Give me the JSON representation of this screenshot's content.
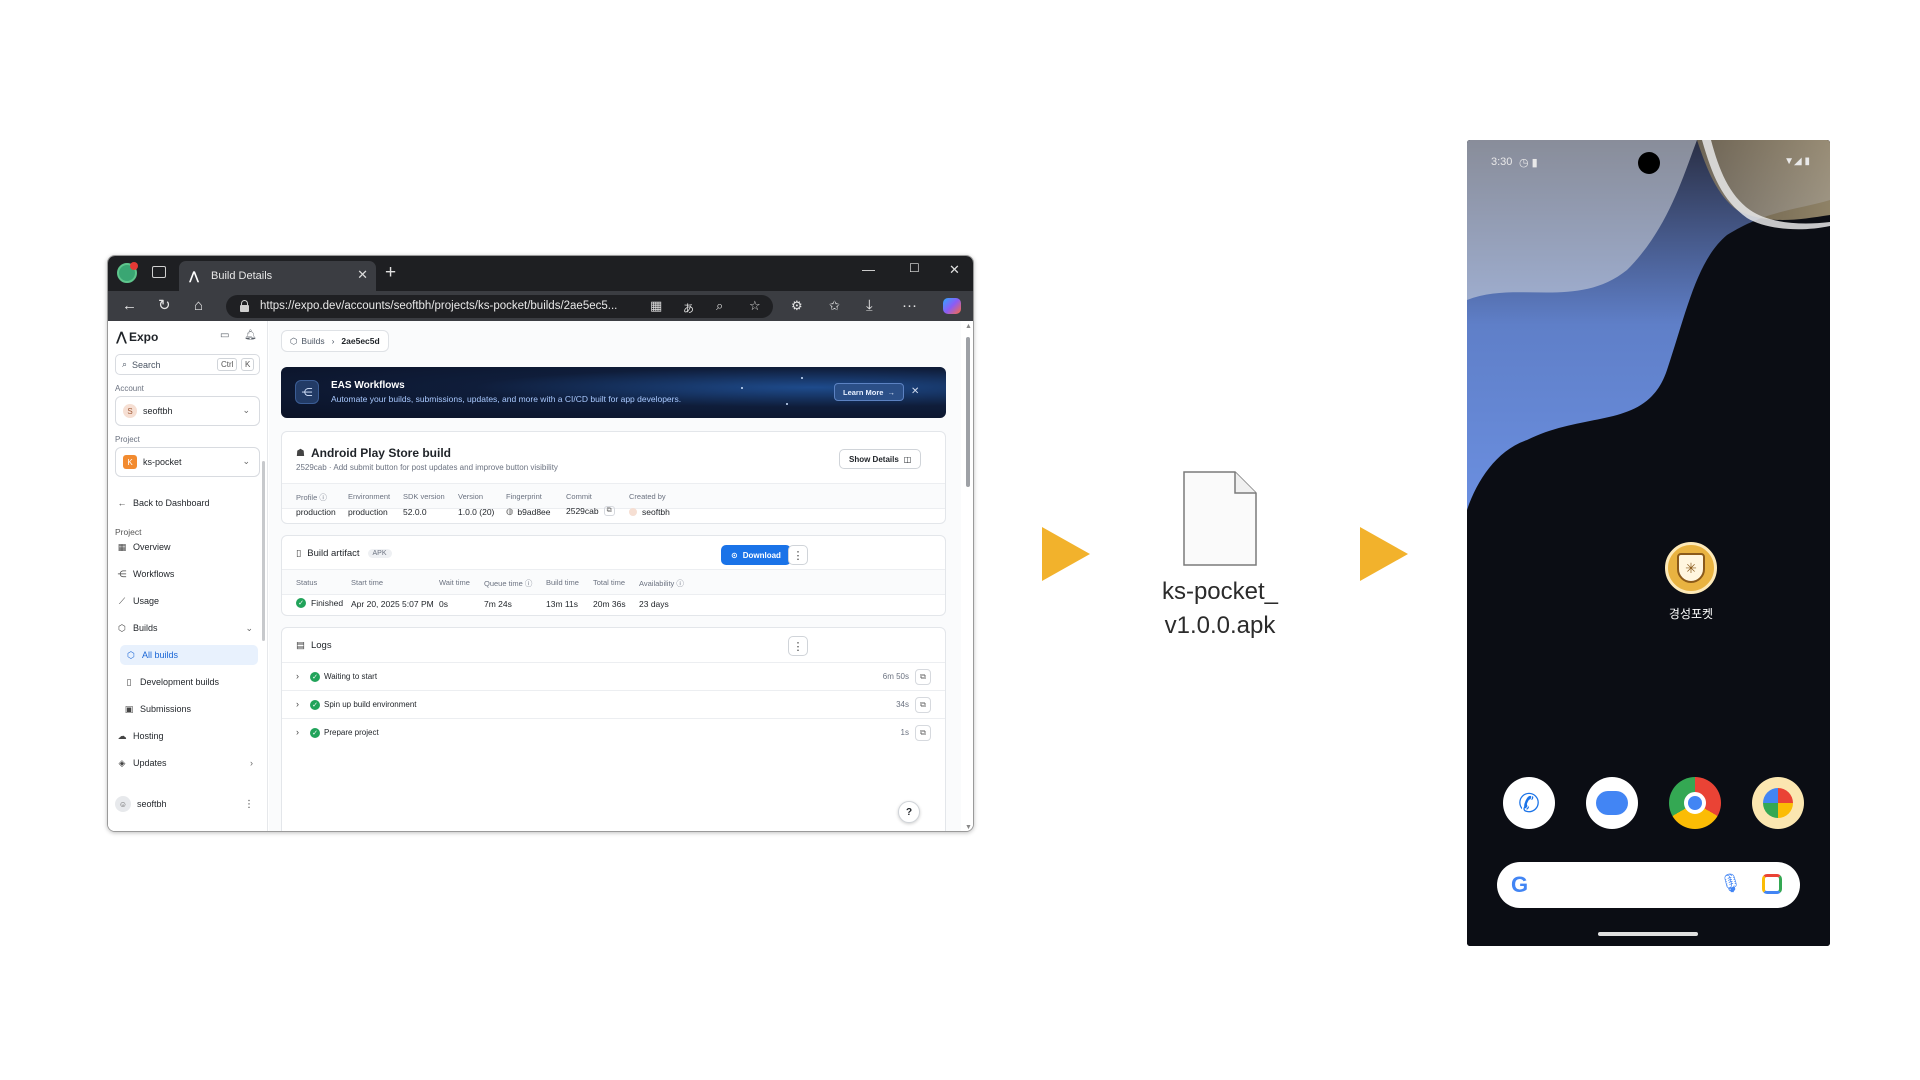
{
  "browser": {
    "tab_title": "Build Details",
    "url": "https://expo.dev/accounts/seoftbh/projects/ks-pocket/builds/2ae5ec5...",
    "icons": [
      "back-arrow-icon",
      "refresh-icon",
      "home-icon",
      "lock-icon",
      "reader-icon",
      "translate-icon",
      "zoom-icon",
      "star-icon",
      "extensions-icon",
      "favorites-icon",
      "download-icon",
      "more-icon",
      "copilot-icon"
    ]
  },
  "sidebar": {
    "brand": "Expo",
    "search_placeholder": "Search",
    "shortcut_ctrl": "Ctrl",
    "shortcut_k": "K",
    "account_label": "Account",
    "account_name": "seoftbh",
    "account_initial": "S",
    "project_label": "Project",
    "project_name": "ks-pocket",
    "project_initial": "K",
    "back": "Back to Dashboard",
    "section": "Project",
    "items": {
      "overview": "Overview",
      "workflows": "Workflows",
      "usage": "Usage",
      "builds": "Builds",
      "all_builds": "All builds",
      "dev_builds": "Development builds",
      "submissions": "Submissions",
      "hosting": "Hosting",
      "updates": "Updates"
    },
    "user": "seoftbh"
  },
  "breadcrumb": {
    "parent": "Builds",
    "current": "2ae5ec5d"
  },
  "banner": {
    "title": "EAS Workflows",
    "subtitle": "Automate your builds, submissions, updates, and more with a CI/CD built for app developers.",
    "button": "Learn More"
  },
  "build": {
    "title": "Android Play Store build",
    "subtitle": "2529cab · Add submit button for post updates and improve button visibility",
    "details_button": "Show Details",
    "headers": [
      "Profile",
      "Environment",
      "SDK version",
      "Version",
      "Fingerprint",
      "Commit",
      "Created by"
    ],
    "values": {
      "profile": "production",
      "environment": "production",
      "sdk": "52.0.0",
      "version": "1.0.0 (20)",
      "fingerprint": "b9ad8ee",
      "commit": "2529cab",
      "created_by": "seoftbh"
    }
  },
  "artifact": {
    "title": "Build artifact",
    "tag": "APK",
    "download": "Download",
    "headers": [
      "Status",
      "Start time",
      "Wait time",
      "Queue time",
      "Build time",
      "Total time",
      "Availability"
    ],
    "values": {
      "status": "Finished",
      "start": "Apr 20, 2025 5:07 PM",
      "wait": "0s",
      "queue": "7m 24s",
      "build": "13m 11s",
      "total": "20m 36s",
      "availability": "23 days"
    }
  },
  "logs": {
    "title": "Logs",
    "rows": [
      {
        "label": "Waiting to start",
        "duration": "6m 50s"
      },
      {
        "label": "Spin up build environment",
        "duration": "34s"
      },
      {
        "label": "Prepare project",
        "duration": "1s"
      }
    ]
  },
  "help": "?",
  "file": {
    "name_line1": "ks-pocket_",
    "name_line2": "v1.0.0.apk"
  },
  "phone": {
    "time": "3:30",
    "app_label": "경성포켓",
    "dock": [
      "phone-app-icon",
      "messages-app-icon",
      "chrome-app-icon",
      "photos-app-icon"
    ],
    "search_logo": "G"
  },
  "colors": {
    "arrow": "#f2b22c",
    "accent": "#1a73e8",
    "success": "#21a35a"
  }
}
